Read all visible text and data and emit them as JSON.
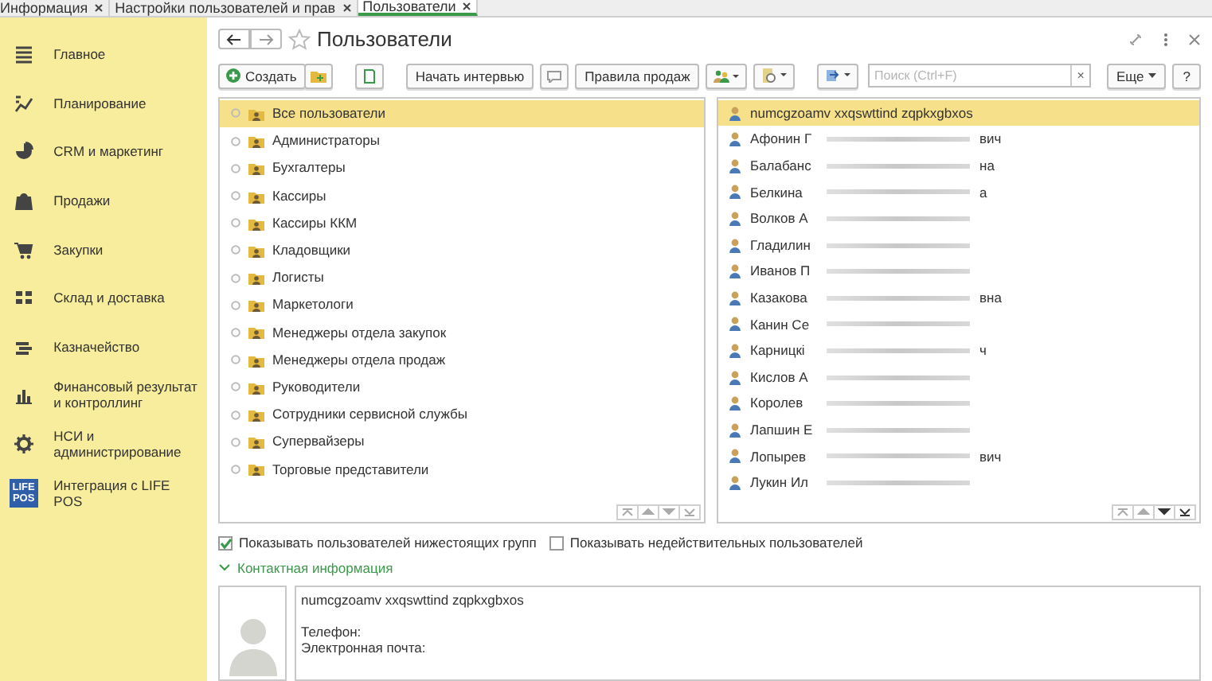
{
  "tabs": [
    {
      "label": "Информация",
      "selected": false
    },
    {
      "label": "Настройки пользователей и прав",
      "selected": false
    },
    {
      "label": "Пользователи",
      "selected": true
    }
  ],
  "sidebar": {
    "items": [
      {
        "label": "Главное",
        "kind": "plain"
      },
      {
        "label": "Планирование",
        "kind": "plain"
      },
      {
        "label": "CRM и маркетинг",
        "kind": "plain"
      },
      {
        "label": "Продажи",
        "kind": "plain"
      },
      {
        "label": "Закупки",
        "kind": "plain"
      },
      {
        "label": "Склад и доставка",
        "kind": "plain"
      },
      {
        "label": "Казначейство",
        "kind": "plain"
      },
      {
        "label": "Финансовый результат и контроллинг",
        "kind": "plain"
      },
      {
        "label": "НСИ и администрирование",
        "kind": "plain"
      },
      {
        "label": "Интеграция с LIFE POS",
        "kind": "logo",
        "logo_top": "LIFE",
        "logo_bottom": "POS"
      }
    ]
  },
  "form": {
    "title": "Пользователи",
    "toolbar": {
      "create": "Создать",
      "interview": "Начать интервью",
      "sales_rules": "Правила продаж",
      "search_placeholder": "Поиск (Ctrl+F)",
      "search_clear": "×",
      "more": "Еще",
      "help": "?"
    },
    "groups": [
      {
        "label": "Все пользователи",
        "selected": true
      },
      {
        "label": "Администраторы",
        "selected": false
      },
      {
        "label": "Бухгалтеры",
        "selected": false
      },
      {
        "label": "Кассиры",
        "selected": false
      },
      {
        "label": "Кассиры ККМ",
        "selected": false
      },
      {
        "label": "Кладовщики",
        "selected": false
      },
      {
        "label": "Логисты",
        "selected": false
      },
      {
        "label": "Маркетологи",
        "selected": false
      },
      {
        "label": "Менеджеры отдела закупок",
        "selected": false
      },
      {
        "label": "Менеджеры отдела продаж",
        "selected": false
      },
      {
        "label": "Руководители",
        "selected": false
      },
      {
        "label": "Сотрудники сервисной службы",
        "selected": false
      },
      {
        "label": "Супервайзеры",
        "selected": false
      },
      {
        "label": "Торговые представители",
        "selected": false
      }
    ],
    "users": [
      {
        "name": "numcgzoamv xxqswttind zqpkxgbxos",
        "selected": true
      },
      {
        "name": "Афонин Г",
        "tail": "вич",
        "selected": false
      },
      {
        "name": "Балабанс",
        "tail": "на",
        "selected": false
      },
      {
        "name": "Белкина",
        "tail": "а",
        "selected": false
      },
      {
        "name": "Волков А",
        "selected": false
      },
      {
        "name": "Гладилин",
        "selected": false
      },
      {
        "name": "Иванов П",
        "selected": false
      },
      {
        "name": "Казакова",
        "tail": "вна",
        "selected": false
      },
      {
        "name": "Канин Се",
        "selected": false
      },
      {
        "name": "Карницкі",
        "tail": "ч",
        "selected": false
      },
      {
        "name": "Кислов А",
        "selected": false
      },
      {
        "name": "Королев",
        "selected": false
      },
      {
        "name": "Лапшин Е",
        "selected": false
      },
      {
        "name": "Лопырев",
        "tail": "вич",
        "selected": false
      },
      {
        "name": "Лукин Ил",
        "selected": false
      }
    ],
    "options": [
      {
        "label": "Показывать пользователей нижестоящих групп",
        "checked": true
      },
      {
        "label": "Показывать недействительных пользователей",
        "checked": false
      }
    ],
    "contact": {
      "heading": "Контактная информация",
      "expanded": true,
      "name": "numcgzoamv xxqswttind zqpkxgbxos",
      "phone_label": "Телефон:",
      "email_label": "Электронная почта:"
    }
  }
}
